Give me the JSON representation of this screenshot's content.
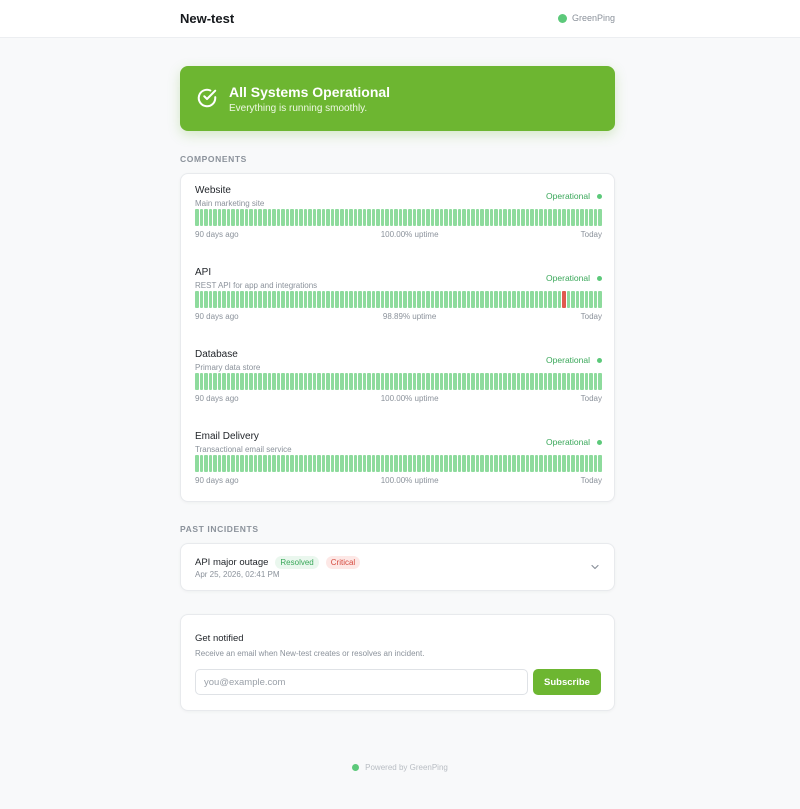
{
  "header": {
    "title": "New-test",
    "brand": "GreenPing",
    "brand_dot_color": "#5cc97a"
  },
  "banner": {
    "icon": "check-circle-icon",
    "title": "All Systems Operational",
    "subtitle": "Everything is running smoothly.",
    "color": "#6db631"
  },
  "components_label": "COMPONENTS",
  "components": [
    {
      "name": "Website",
      "description": "Main marketing site",
      "status": "Operational",
      "start": "90 days ago",
      "uptime": "100.00% uptime",
      "end": "Today",
      "days": 90,
      "down_days": []
    },
    {
      "name": "API",
      "description": "REST API for app and integrations",
      "status": "Operational",
      "start": "90 days ago",
      "uptime": "98.89% uptime",
      "end": "Today",
      "days": 90,
      "down_days": [
        81
      ]
    },
    {
      "name": "Database",
      "description": "Primary data store",
      "status": "Operational",
      "start": "90 days ago",
      "uptime": "100.00% uptime",
      "end": "Today",
      "days": 90,
      "down_days": []
    },
    {
      "name": "Email Delivery",
      "description": "Transactional email service",
      "status": "Operational",
      "start": "90 days ago",
      "uptime": "100.00% uptime",
      "end": "Today",
      "days": 90,
      "down_days": []
    }
  ],
  "incidents_label": "PAST INCIDENTS",
  "incidents": [
    {
      "title": "API major outage",
      "status_badge": "Resolved",
      "severity_badge": "Critical",
      "date": "Apr 25, 2026, 02:41 PM"
    }
  ],
  "notify": {
    "title": "Get notified",
    "subtitle": "Receive an email when New-test creates or resolves an incident.",
    "placeholder": "you@example.com",
    "button": "Subscribe"
  },
  "footer": {
    "text": "Powered by GreenPing"
  },
  "colors": {
    "up": "#8edb9d",
    "down": "#e05a4f",
    "operational": "#3aa85a"
  }
}
